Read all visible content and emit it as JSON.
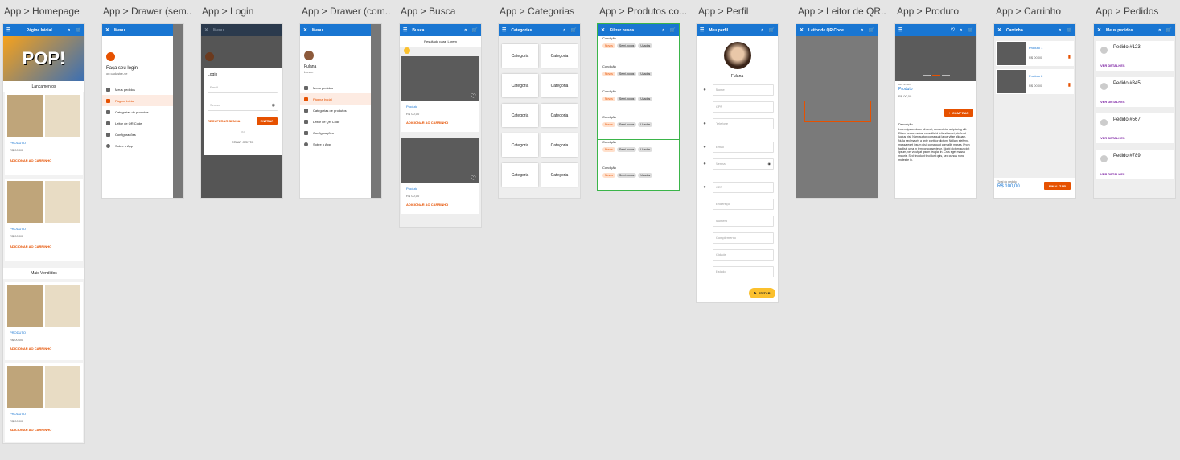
{
  "frames": [
    {
      "title": "App > Homepage"
    },
    {
      "title": "App > Drawer (sem..."
    },
    {
      "title": "App > Login"
    },
    {
      "title": "App > Drawer (com..."
    },
    {
      "title": "App > Busca"
    },
    {
      "title": "App > Categorias"
    },
    {
      "title": "App > Produtos co..."
    },
    {
      "title": "App > Perfil"
    },
    {
      "title": "App > Leitor de QR..."
    },
    {
      "title": "App > Produto"
    },
    {
      "title": "App > Carrinho"
    },
    {
      "title": "App > Pedidos"
    }
  ],
  "homepage": {
    "appbar": "Página Inicial",
    "banner": "POP!",
    "section1": "Lançamentos",
    "section2": "Mais Vendidos",
    "product_name": "PRODUTO",
    "product_price": "R$ 00,00",
    "add_to_cart": "ADICIONAR AO CARRINHO"
  },
  "drawer_guest": {
    "appbar": "Menu",
    "login_prompt": "Faça seu login",
    "register": "ou cadastre-se",
    "items": [
      "Meus pedidos",
      "Página Inicial",
      "Categorias de produtos",
      "Leitor de QR Code",
      "Configurações",
      "Sobre o App"
    ]
  },
  "login": {
    "appbar": "Menu",
    "title": "Login",
    "email": "Email",
    "password": "Senha",
    "recover": "RECUPERAR SENHA",
    "submit": "ENTRAR",
    "or": "ou",
    "create": "CRIAR CONTA"
  },
  "drawer_user": {
    "appbar": "Menu",
    "name": "Fulana",
    "sub": "Lorem",
    "items": [
      "Meus pedidos",
      "Página Inicial",
      "Categorias de produtos",
      "Leitor de QR Code",
      "Configurações",
      "Sobre o App"
    ]
  },
  "busca": {
    "appbar": "Busca",
    "result": "Resultado para: Lorem",
    "product": "Produto",
    "price": "R$ 00,00",
    "add": "ADICIONAR AO CARRINHO"
  },
  "categorias": {
    "appbar": "Categorias",
    "label": "Categoria"
  },
  "filtro": {
    "appbar": "Filtrar busca",
    "condition": "Condição",
    "chips": [
      "Novos",
      "Semi-novos",
      "Usados"
    ]
  },
  "perfil": {
    "appbar": "Meu perfil",
    "name": "Fulana",
    "fields": [
      "Nome",
      "CPF",
      "Telefone",
      "Email",
      "Senha",
      "CEP",
      "Endereço",
      "Número",
      "Complemento",
      "Cidade",
      "Estado"
    ],
    "edit": "EDITAR"
  },
  "qr": {
    "appbar": "Leitor de QR Code"
  },
  "produto": {
    "brand": "ALL STARS",
    "name": "Produto",
    "price": "R$ 00,00",
    "buy": "COMPRAR",
    "desc_title": "Descrição",
    "desc": "Lorem ipsum dolor sit amet, consectetur adipiscing elit. Etiam neque metus, convallis id felis sit amet, eleifend luctus nisl. Nam auctor consequat lacus vitae aliquam. Nulla sed mauris a ante porttitor dictum. Nullam eleifend, massa eget ipsum nisi, consequat convallis massa. Proin facilisis urna in tempor consectetur. Morbi dictum suscipit ipsum, vel volutpat ipsum feugiat in. Cras eget massa mauris. Sed tincidunt tincidunt quis, sed cursus nunc molestie in."
  },
  "carrinho": {
    "appbar": "Carrinho",
    "items": [
      {
        "name": "Produto 1",
        "price": "R$ 00,00"
      },
      {
        "name": "Produto 2",
        "price": "R$ 00,00"
      }
    ],
    "total_label": "Total do pedido",
    "total": "R$ 100,00",
    "finish": "FINALIZAR"
  },
  "pedidos": {
    "appbar": "Meus pedidos",
    "orders": [
      "Pedido #123",
      "Pedido #345",
      "Pedido #567",
      "Pedido #789"
    ],
    "details": "VER DETALHES"
  },
  "colors": {
    "primary": "#1976d2",
    "accent": "#e65100",
    "edit": "#fbc02d",
    "details": "#7b1fa2"
  }
}
